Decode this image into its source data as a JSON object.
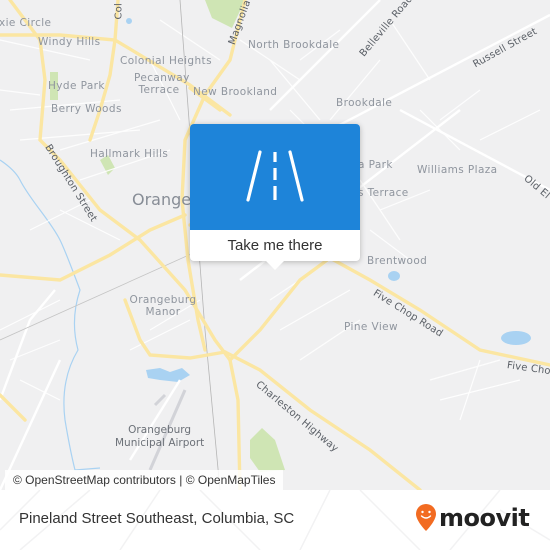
{
  "map": {
    "colors": {
      "background": "#f0f0f1",
      "major_road": "#fbe6a2",
      "minor_road": "#ffffff",
      "water": "#a9d2f2",
      "park": "#cfe5b4",
      "rail": "#b5b5b5"
    },
    "places": {
      "dixie_circle": "xie Circle",
      "windy_hills": "Windy Hills",
      "colonial_heights": "Colonial Heights",
      "pecanway_terrace_1": "Pecanway",
      "pecanway_terrace_2": "Terrace",
      "new_brookland": "New Brookland",
      "north_brookdale": "North Brookdale",
      "hyde_park": "Hyde Park",
      "berry_woods": "Berry Woods",
      "brookdale": "Brookdale",
      "hallmark_hills": "Hallmark Hills",
      "williams_plaza": "Williams Plaza",
      "park_partial": "a Park",
      "terrace_partial": "s Terrace",
      "brentwood": "Brentwood",
      "pine_view": "Pine View",
      "orangeburg_manor_1": "Orangeburg",
      "orangeburg_manor_2": "Manor",
      "city": "Orangeb"
    },
    "roads": {
      "columbia_partial": "Col",
      "magnolia": "Magnolia",
      "belleville": "Belleville Road",
      "russell": "Russell Street",
      "old_elloree": "Old El",
      "broughton": "Broughton Street",
      "five_chop_1": "Five Chop Road",
      "five_chop_2": "Five Cho",
      "charleston": "Charleston Highway"
    },
    "airport": {
      "line1": "Orangeburg",
      "line2": "Municipal Airport"
    }
  },
  "popup": {
    "icon": "road-icon",
    "action_label": "Take me there",
    "banner_color": "#1e84d9"
  },
  "attribution": "© OpenStreetMap contributors | © OpenMapTiles",
  "footer": {
    "address": "Pineland Street Southeast, Columbia, SC",
    "brand": "moovit",
    "brand_color": "#f26b21"
  }
}
